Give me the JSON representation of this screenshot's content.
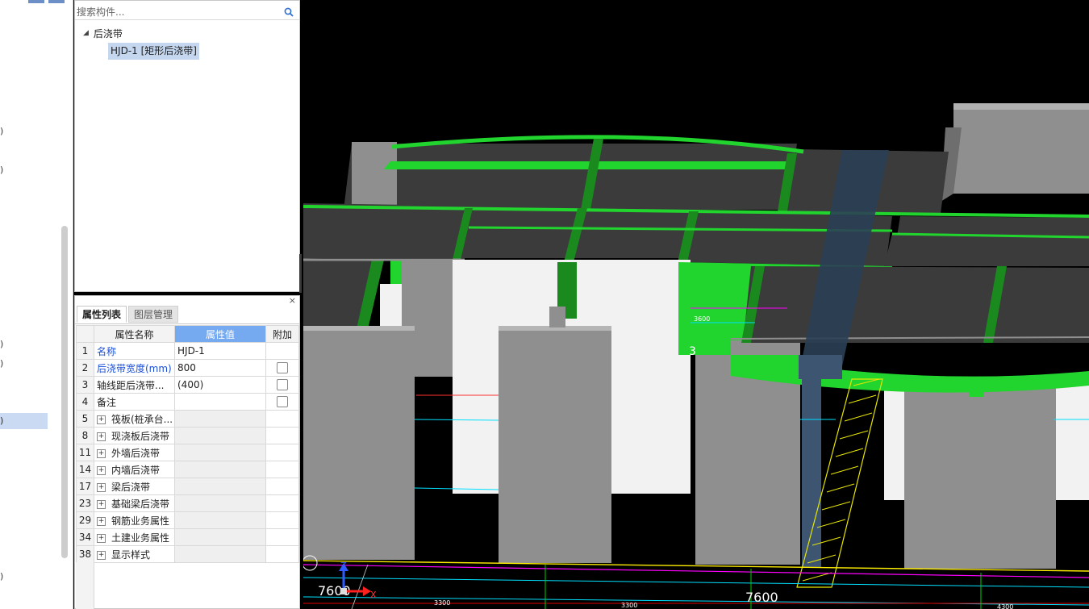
{
  "left_strip": {
    "fragments": [
      ")",
      ")",
      ")",
      ")",
      ")",
      ")"
    ],
    "selected_fragment": ")"
  },
  "tree_panel": {
    "search_placeholder": "搜索构件...",
    "root_label": "后浇带",
    "child_label": "HJD-1 [矩形后浇带]"
  },
  "property_panel": {
    "close_glyph": "×",
    "tabs": [
      {
        "label": "属性列表",
        "active": true
      },
      {
        "label": "图层管理",
        "active": false
      }
    ],
    "columns": [
      "属性名称",
      "属性值",
      "附加"
    ],
    "rows": [
      {
        "num": "1",
        "name": "名称",
        "value": "HJD-1",
        "highlight": true,
        "checkbox": false,
        "expandable": false
      },
      {
        "num": "2",
        "name": "后浇带宽度(mm)",
        "value": "800",
        "highlight": true,
        "checkbox": true,
        "expandable": false
      },
      {
        "num": "3",
        "name": "轴线距后浇带...",
        "value": "(400)",
        "highlight": false,
        "checkbox": true,
        "expandable": false
      },
      {
        "num": "4",
        "name": "备注",
        "value": "",
        "highlight": false,
        "checkbox": true,
        "expandable": false
      },
      {
        "num": "5",
        "name": "筏板(桩承台...",
        "value": "",
        "highlight": false,
        "checkbox": false,
        "expandable": true
      },
      {
        "num": "8",
        "name": "现浇板后浇带",
        "value": "",
        "highlight": false,
        "checkbox": false,
        "expandable": true
      },
      {
        "num": "11",
        "name": "外墙后浇带",
        "value": "",
        "highlight": false,
        "checkbox": false,
        "expandable": true
      },
      {
        "num": "14",
        "name": "内墙后浇带",
        "value": "",
        "highlight": false,
        "checkbox": false,
        "expandable": true
      },
      {
        "num": "17",
        "name": "梁后浇带",
        "value": "",
        "highlight": false,
        "checkbox": false,
        "expandable": true
      },
      {
        "num": "23",
        "name": "基础梁后浇带",
        "value": "",
        "highlight": false,
        "checkbox": false,
        "expandable": true
      },
      {
        "num": "29",
        "name": "钢筋业务属性",
        "value": "",
        "highlight": false,
        "checkbox": false,
        "expandable": true
      },
      {
        "num": "34",
        "name": "土建业务属性",
        "value": "",
        "highlight": false,
        "checkbox": false,
        "expandable": true
      },
      {
        "num": "38",
        "name": "显示样式",
        "value": "",
        "highlight": false,
        "checkbox": false,
        "expandable": true
      }
    ]
  },
  "viewport": {
    "dim_left": "7600",
    "dim_right": "7600",
    "dim_small": [
      "3600",
      "3300",
      "3300",
      "4300"
    ],
    "axis_z": "Z",
    "axis_x": "X",
    "fragment_3": "3",
    "colors": {
      "slab": "#3b3b3b",
      "beam_green": "#22d42e",
      "beam_green_dark": "#1a8a1e",
      "column": "#8f8f8f",
      "column_side": "#6e6e6e",
      "wall_white": "#f2f2f2",
      "post_pour_strip": "#3d5570",
      "hatch": "#e6e600"
    }
  }
}
